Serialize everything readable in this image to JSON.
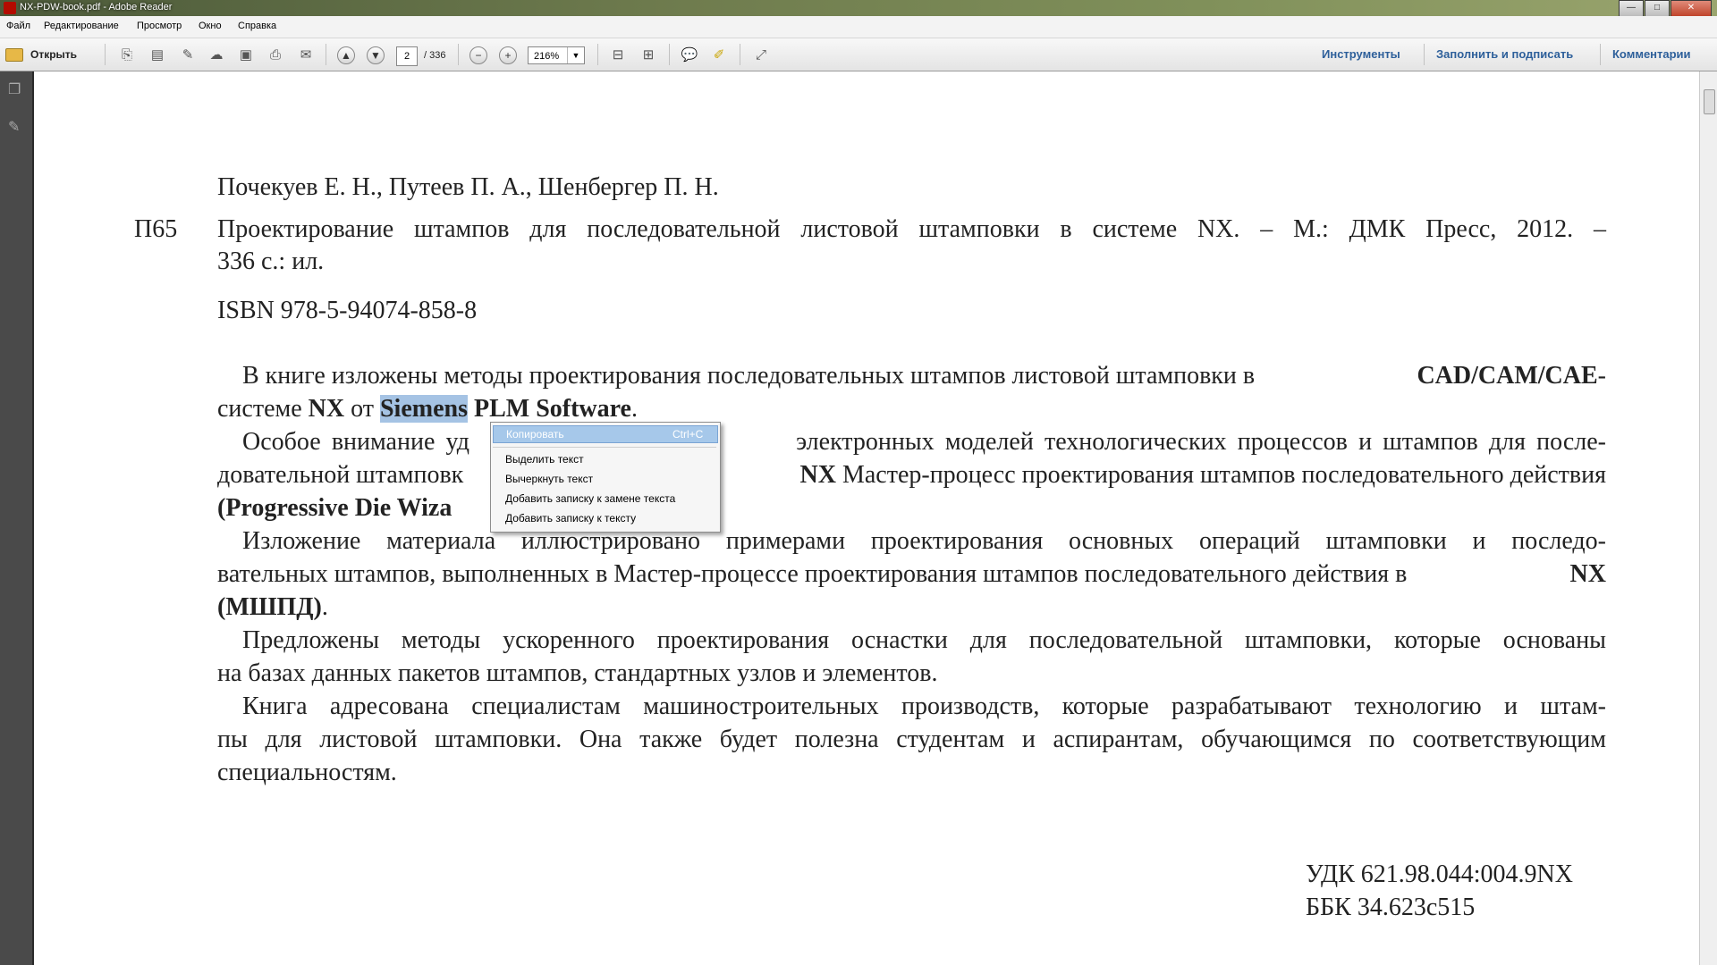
{
  "window": {
    "title": "NX-PDW-book.pdf - Adobe Reader",
    "controls": {
      "minimize": "—",
      "maximize": "□",
      "close": "✕"
    }
  },
  "menu": [
    "Файл",
    "Редактирование",
    "Просмотр",
    "Окно",
    "Справка"
  ],
  "toolbar": {
    "open_label": "Открыть",
    "page_current": "2",
    "page_total": "/ 336",
    "zoom": "216%",
    "tools_label": "Инструменты",
    "fill_sign_label": "Заполнить и подписать",
    "comments_label": "Комментарии"
  },
  "document": {
    "authors": "Почекуев Е. Н., Путеев П. А., Шенбергер П. Н.",
    "index_code": "П65",
    "title_line1": "Проектирование штампов для последовательной листовой штамповки в системе NX. – М.: ДМК Пресс, 2012. –",
    "title_line2": "336 с.: ил.",
    "isbn": "ISBN 978-5-94074-858-8",
    "p1_l1_text": "В книге изложены  методы проектирования последовательных штампов листовой штамповки в",
    "p1_l1_bold": "CAD/CAM/CAE",
    "p1_l1_end": "-",
    "p1_l2_a": "системе",
    "p1_l2_nx": "NX",
    "p1_l2_b": "от",
    "p1_l2_sel": "Siemens",
    "p1_l2_bold": "PLM Software",
    "p1_l2_end": ".",
    "p2_l1": "Особое внимание уд                              электронных моделей технологических процессов и штампов для после-",
    "p2_l2_a": "довательной штамповк",
    "p2_l2_bold": "NX",
    "p2_l2_b": "Мастер-процесс проектирования штампов последовательного действия",
    "p2_l3_bold": "(Progressive Die Wiza",
    "p3_l1": "Изложение материала иллюстрировано примерами проектирования основных операций  штамповки и последо-",
    "p3_l2_a": "вательных штампов, выполненных в Мастер-процессе проектирования штампов последовательного действия в",
    "p3_l2_bold": "NX",
    "p3_l3_bold": "(МШПД)",
    "p3_l3_end": ".",
    "p4_l1": "Предложены методы ускоренного проектирования оснастки для последовательной штамповки, которые основаны",
    "p4_l2": "на базах данных пакетов штампов, стандартных узлов и элементов.",
    "p5_l1": "Книга адресована специалистам машиностроительных производств, которые разрабатывают технологию и штам-",
    "p5_l2": "пы  для листовой штамповки. Она также будет полезна студентам и аспирантам, обучающимся по соответствующим",
    "p5_l3": "специальностям.",
    "udk": "УДК 621.98.044:004.9NX",
    "bbk": "ББК 34.623с515"
  },
  "context_menu": {
    "copy": "Копировать",
    "copy_shortcut": "Ctrl+C",
    "select_text": "Выделить текст",
    "strike_text": "Вычеркнуть текст",
    "add_replace_note": "Добавить записку к замене текста",
    "add_note": "Добавить записку к тексту"
  },
  "icons": {
    "accent_link_color": "#2d5f9a",
    "selection_color": "#a5c3e4"
  }
}
